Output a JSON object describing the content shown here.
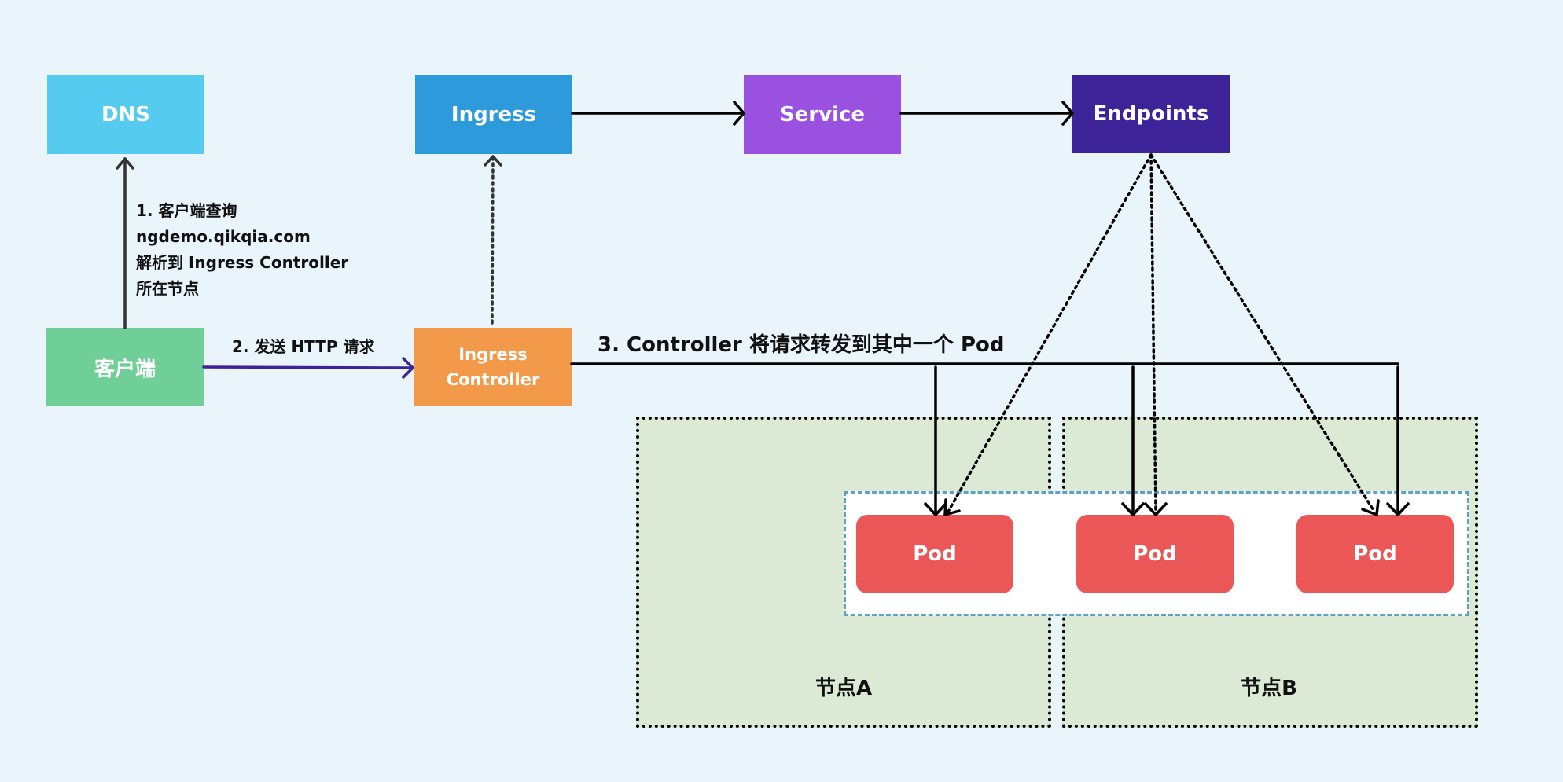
{
  "boxes": {
    "dns": "DNS",
    "ingress": "Ingress",
    "service": "Service",
    "endpoints": "Endpoints",
    "client": "客户端",
    "controller_line1": "Ingress",
    "controller_line2": "Controller"
  },
  "steps": {
    "step1": [
      "1. 客户端查询",
      "ngdemo.qikqia.com",
      "解析到 Ingress Controller",
      "所在节点"
    ],
    "step2": "2. 发送 HTTP 请求",
    "step3": "3. Controller 将请求转发到其中一个 Pod"
  },
  "nodes": {
    "a": "节点A",
    "b": "节点B"
  },
  "pods": [
    "Pod",
    "Pod",
    "Pod"
  ],
  "colors": {
    "background": "#EAF4FB",
    "dns": "#55CBF0",
    "ingress": "#2D9BDB",
    "service": "#9B51E0",
    "endpoints": "#3C2398",
    "client": "#6FCF97",
    "controller": "#F2994A",
    "pod": "#EB5757",
    "node": "#DBE9D5",
    "http_arrow": "#3C2398"
  }
}
